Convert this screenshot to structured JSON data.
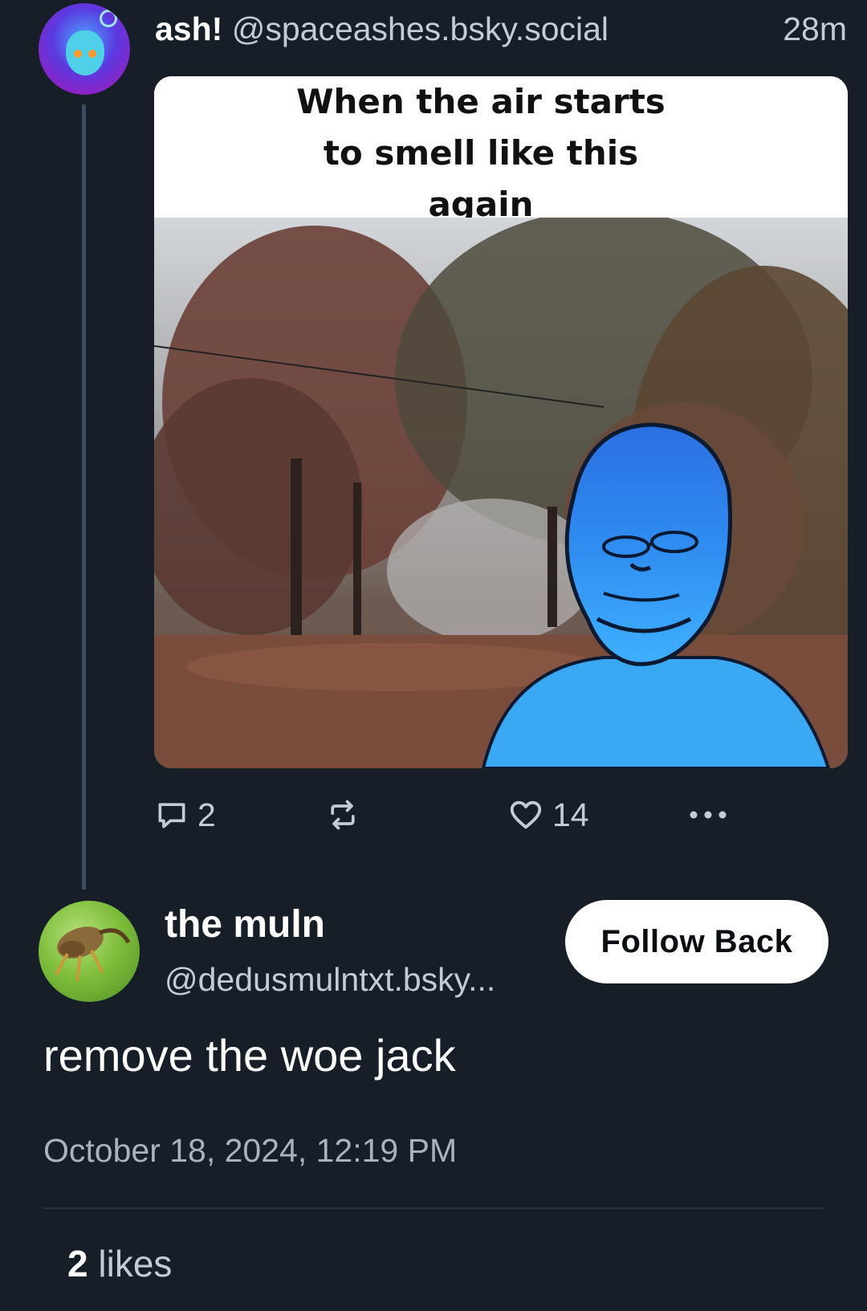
{
  "parent_post": {
    "display_name": "ash!",
    "handle": "@spaceashes.bsky.social",
    "time_ago": "28m",
    "image_caption": [
      "When the air starts",
      "to smell like this",
      "again"
    ],
    "reply_count": "2",
    "like_count": "14"
  },
  "reply_post": {
    "display_name": "the muln",
    "handle": "@dedusmulntxt.bsky...",
    "follow_label": "Follow Back",
    "text": "remove the woe jack",
    "date": "October 18, 2024, 12:19 PM",
    "likes_count": "2",
    "likes_label": " likes"
  },
  "icons": {
    "reply": "speech-bubble-icon",
    "repost": "repost-arrows-icon",
    "like": "heart-outline-icon",
    "more": "ellipsis-icon"
  },
  "colors": {
    "background": "#161e27",
    "text_primary": "#ffffff",
    "text_secondary": "#c4cbd4",
    "thread_line": "#3a4c61",
    "button_bg": "#ffffff"
  }
}
